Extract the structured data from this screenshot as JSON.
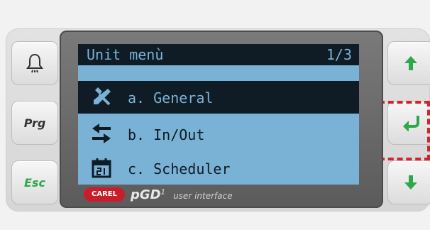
{
  "device": {
    "brand_badge": "CAREL",
    "brand_name": "pGD",
    "brand_superscript": "1",
    "brand_subtitle": "user interface",
    "colors": {
      "lcd_background": "#7ab2d6",
      "lcd_foreground": "#0f1b25",
      "accent_green": "#2ea84a",
      "highlight_red": "#d4232a"
    }
  },
  "screen": {
    "title": "Unit menù",
    "page": "1/3",
    "items": [
      {
        "label": "a. General",
        "icon": "tools-icon",
        "selected": true
      },
      {
        "label": "b. In/Out",
        "icon": "in-out-arrows-icon",
        "selected": false
      },
      {
        "label": "c. Scheduler",
        "icon": "calendar-icon",
        "selected": false
      }
    ]
  },
  "buttons": {
    "alarm": {
      "icon": "bell-icon"
    },
    "prg": {
      "label": "Prg"
    },
    "esc": {
      "label": "Esc"
    },
    "up": {
      "icon": "arrow-up-icon"
    },
    "enter": {
      "icon": "enter-icon"
    },
    "down": {
      "icon": "arrow-down-icon"
    }
  }
}
